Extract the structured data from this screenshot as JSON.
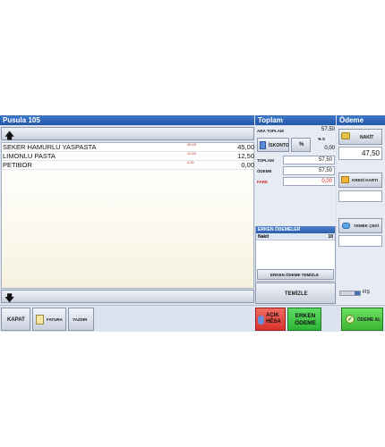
{
  "receipt": {
    "title": "Pusula 105"
  },
  "items": [
    {
      "name": "SEKER HAMURLU YASPASTA",
      "unit_price": "45,00",
      "total": "45,00"
    },
    {
      "name": "LIMONLU PASTA",
      "unit_price": "12,50",
      "total": "12,50"
    },
    {
      "name": "PETIBOR",
      "unit_price": "0,00",
      "total": "0,00"
    }
  ],
  "totals": {
    "title": "Toplam",
    "subtotal_label": "ARA TOPLAM",
    "subtotal_value": "57,50",
    "discount_button": "İSKONTO",
    "percent_button": "%",
    "discount_percent_label": "% 0",
    "discount_value": "0,00",
    "total_label": "TOPLAM",
    "total_value": "57,50",
    "payment_label": "ÖDEME",
    "payment_value": "57,50",
    "difference_label": "FARK",
    "difference_value": "0,00"
  },
  "early_payments": {
    "title": "ERKEN ÖDEMELER",
    "rows": [
      {
        "name": "Nakit",
        "value": "10"
      }
    ],
    "clear_button": "ERKEN ÖDEME TEMİZLE"
  },
  "clear_button": "TEMİZLE",
  "payment": {
    "title": "Ödeme",
    "cash_button": "NAKİT",
    "cash_value": "47,50",
    "card_button": "KREDİ KARTI",
    "card_value": "",
    "meal_button": "YEMEK ÇEKİ",
    "meal_value": "",
    "receipt_toggle_label": "FİŞ"
  },
  "footer": {
    "close_button": "KAPAT",
    "invoice_button": "FATURA",
    "print_button": "YAZDIR",
    "open_account_button": "AÇIK HESA",
    "early_payment_button": "ERKEN ÖDEME",
    "receive_payment_button": "ÖDEME AL"
  },
  "colors": {
    "title_bar": "#3f78c8",
    "open_account": "#e8403a",
    "early_payment": "#42c94a",
    "receive_payment": "#4ec93f",
    "difference_red": "#cc2222"
  }
}
